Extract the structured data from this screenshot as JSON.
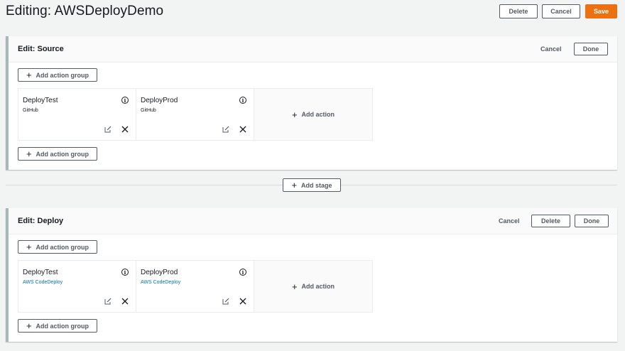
{
  "header": {
    "title": "Editing: AWSDeployDemo",
    "delete_label": "Delete",
    "cancel_label": "Cancel",
    "save_label": "Save"
  },
  "stages": [
    {
      "title": "Edit: Source",
      "cancel_label": "Cancel",
      "done_label": "Done",
      "add_group_label": "Add action group",
      "add_action_label": "Add action",
      "actions": [
        {
          "name": "DeployTest",
          "provider": "GitHub"
        },
        {
          "name": "DeployProd",
          "provider": "GitHub"
        }
      ]
    },
    {
      "title": "Edit: Deploy",
      "cancel_label": "Cancel",
      "delete_label": "Delete",
      "done_label": "Done",
      "add_group_label": "Add action group",
      "add_action_label": "Add action",
      "actions": [
        {
          "name": "DeployTest",
          "provider": "AWS CodeDeploy"
        },
        {
          "name": "DeployProd",
          "provider": "AWS CodeDeploy"
        }
      ]
    }
  ],
  "add_stage_label": "Add stage",
  "colors": {
    "accent": "#ec7211",
    "link": "#0073bb",
    "stage_border": "#aab7b8"
  },
  "icons": [
    "plus-icon",
    "info-icon",
    "edit-icon",
    "close-icon"
  ]
}
